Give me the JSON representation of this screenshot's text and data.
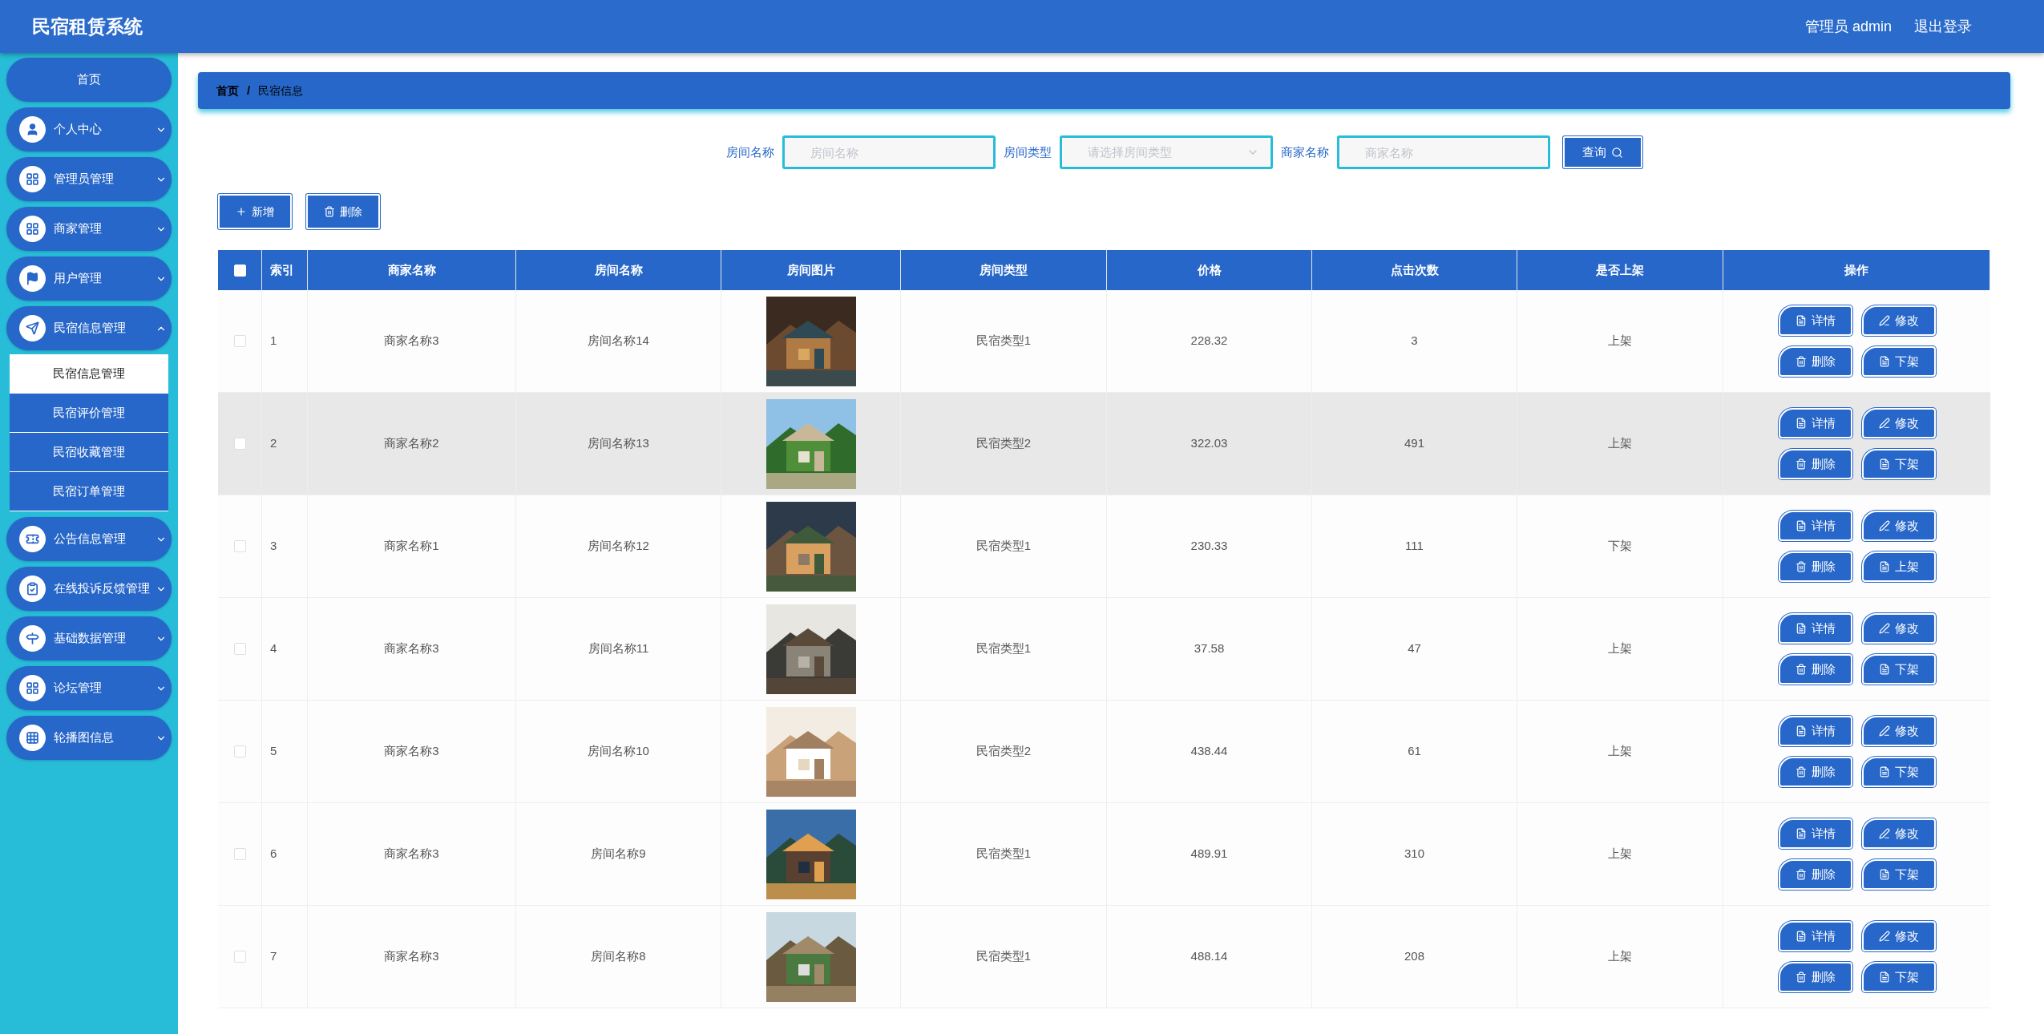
{
  "header": {
    "title": "民宿租赁系统",
    "user": "管理员 admin",
    "logout": "退出登录"
  },
  "sidebar": {
    "items": [
      {
        "label": "首页"
      },
      {
        "label": "个人中心",
        "expanded": false
      },
      {
        "label": "管理员管理",
        "expanded": false
      },
      {
        "label": "商家管理",
        "expanded": false
      },
      {
        "label": "用户管理",
        "expanded": false
      },
      {
        "label": "民宿信息管理",
        "expanded": true,
        "children": [
          {
            "label": "民宿信息管理",
            "selected": true
          },
          {
            "label": "民宿评价管理",
            "selected": false
          },
          {
            "label": "民宿收藏管理",
            "selected": false
          },
          {
            "label": "民宿订单管理",
            "selected": false
          }
        ]
      },
      {
        "label": "公告信息管理",
        "expanded": false
      },
      {
        "label": "在线投诉反馈管理",
        "expanded": false
      },
      {
        "label": "基础数据管理",
        "expanded": false
      },
      {
        "label": "论坛管理",
        "expanded": false
      },
      {
        "label": "轮播图信息",
        "expanded": false
      }
    ]
  },
  "breadcrumb": {
    "items": [
      "首页",
      "民宿信息"
    ],
    "separator": "/"
  },
  "search": {
    "fields": [
      {
        "label": "房间名称",
        "placeholder": "房间名称",
        "kind": "input"
      },
      {
        "label": "房间类型",
        "placeholder": "请选择房间类型",
        "kind": "select"
      },
      {
        "label": "商家名称",
        "placeholder": "商家名称",
        "kind": "input"
      }
    ],
    "button": "查询"
  },
  "toolbar": [
    "新增",
    "删除"
  ],
  "table": {
    "select_all_checked": false,
    "columns": [
      "索引",
      "商家名称",
      "房间名称",
      "房间图片",
      "房间类型",
      "价格",
      "点击次数",
      "是否上架",
      "操作"
    ],
    "rows": [
      {
        "checked": false,
        "highlighted": false,
        "index": "1",
        "merchant": "商家名称3",
        "room": "房间名称14",
        "type": "民宿类型1",
        "price": "228.32",
        "clicks": "3",
        "status": "上架",
        "actions": [
          "详情",
          "修改",
          "删除",
          "下架"
        ]
      },
      {
        "checked": false,
        "highlighted": true,
        "index": "2",
        "merchant": "商家名称2",
        "room": "房间名称13",
        "type": "民宿类型2",
        "price": "322.03",
        "clicks": "491",
        "status": "上架",
        "actions": [
          "详情",
          "修改",
          "删除",
          "下架"
        ]
      },
      {
        "checked": false,
        "highlighted": false,
        "index": "3",
        "merchant": "商家名称1",
        "room": "房间名称12",
        "type": "民宿类型1",
        "price": "230.33",
        "clicks": "111",
        "status": "下架",
        "actions": [
          "详情",
          "修改",
          "删除",
          "上架"
        ]
      },
      {
        "checked": false,
        "highlighted": false,
        "index": "4",
        "merchant": "商家名称3",
        "room": "房间名称11",
        "type": "民宿类型1",
        "price": "37.58",
        "clicks": "47",
        "status": "上架",
        "actions": [
          "详情",
          "修改",
          "删除",
          "下架"
        ]
      },
      {
        "checked": false,
        "highlighted": false,
        "index": "5",
        "merchant": "商家名称3",
        "room": "房间名称10",
        "type": "民宿类型2",
        "price": "438.44",
        "clicks": "61",
        "status": "上架",
        "actions": [
          "详情",
          "修改",
          "删除",
          "下架"
        ]
      },
      {
        "checked": false,
        "highlighted": false,
        "index": "6",
        "merchant": "商家名称3",
        "room": "房间名称9",
        "type": "民宿类型1",
        "price": "489.91",
        "clicks": "310",
        "status": "上架",
        "actions": [
          "详情",
          "修改",
          "删除",
          "下架"
        ]
      },
      {
        "checked": false,
        "highlighted": false,
        "index": "7",
        "merchant": "商家名称3",
        "room": "房间名称8",
        "type": "民宿类型1",
        "price": "488.14",
        "clicks": "208",
        "status": "上架",
        "actions": [
          "详情",
          "修改",
          "删除",
          "下架"
        ]
      }
    ]
  }
}
